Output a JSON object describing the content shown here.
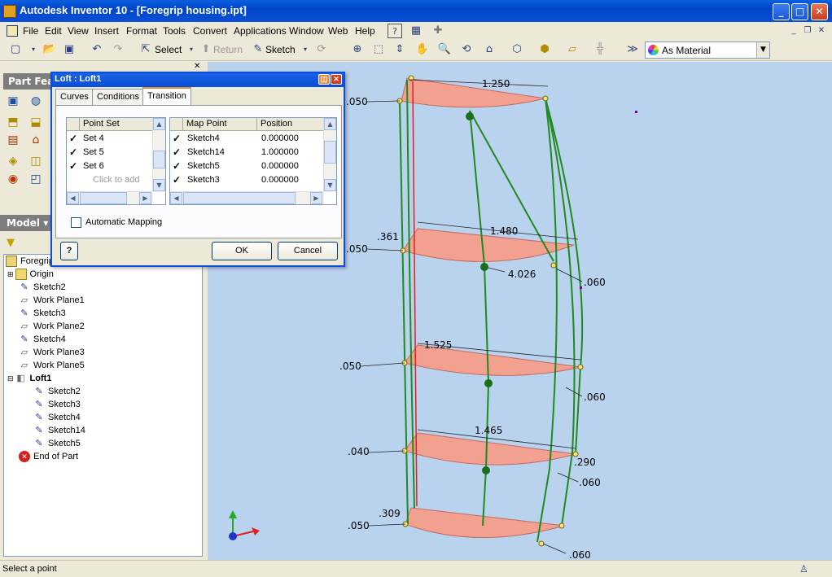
{
  "window": {
    "title": "Autodesk Inventor 10 - [Foregrip housing.ipt]"
  },
  "menu": [
    "File",
    "Edit",
    "View",
    "Insert",
    "Format",
    "Tools",
    "Convert",
    "Applications",
    "Window",
    "Web",
    "Help"
  ],
  "toolbar": {
    "select": "Select",
    "return": "Return",
    "sketch": "Sketch",
    "material": "As Material"
  },
  "panel": {
    "title": "Part Fea",
    "model": "Model"
  },
  "tree": [
    {
      "label": "Foregrip",
      "icon": "part-icon"
    },
    {
      "label": "Origin",
      "icon": "folder-icon"
    },
    {
      "label": "Sketch2",
      "icon": "sketch-icon"
    },
    {
      "label": "Work Plane1",
      "icon": "plane-icon"
    },
    {
      "label": "Sketch3",
      "icon": "sketch-icon"
    },
    {
      "label": "Work Plane2",
      "icon": "plane-icon"
    },
    {
      "label": "Sketch4",
      "icon": "sketch-icon"
    },
    {
      "label": "Work Plane3",
      "icon": "plane-icon"
    },
    {
      "label": "Work Plane5",
      "icon": "plane-icon"
    },
    {
      "label": "Loft1",
      "icon": "loft-icon"
    },
    {
      "label": "Sketch2",
      "icon": "sketch-icon"
    },
    {
      "label": "Sketch3",
      "icon": "sketch-icon"
    },
    {
      "label": "Sketch4",
      "icon": "sketch-icon"
    },
    {
      "label": "Sketch14",
      "icon": "sketch-icon"
    },
    {
      "label": "Sketch5",
      "icon": "sketch-icon"
    },
    {
      "label": "End of Part",
      "icon": "end-of-part-icon"
    }
  ],
  "dialog": {
    "title": "Loft : Loft1",
    "tabs": [
      "Curves",
      "Conditions",
      "Transition"
    ],
    "active_tab": "Transition",
    "pointset_header": "Point Set",
    "pointsets": [
      "Set 4",
      "Set 5",
      "Set 6"
    ],
    "pointset_add": "Click to add",
    "map_headers": [
      "Map Point",
      "Position"
    ],
    "map_rows": [
      {
        "point": "Sketch4",
        "pos": "0.000000"
      },
      {
        "point": "Sketch14",
        "pos": "1.000000"
      },
      {
        "point": "Sketch5",
        "pos": "0.000000"
      },
      {
        "point": "Sketch3",
        "pos": "0.000000"
      }
    ],
    "auto_mapping": "Automatic Mapping",
    "ok": "OK",
    "cancel": "Cancel"
  },
  "dims": {
    "d1250": "1.250",
    "d1480": "1.480",
    "d1525": "1.525",
    "d1465": "1.465",
    "d050a": ".050",
    "d050b": ".050",
    "d050c": ".050",
    "d050d": ".050",
    "d040": ".040",
    "d361": ".361",
    "d4026": "4.026",
    "d060a": ".060",
    "d060b": ".060",
    "d060c": ".060",
    "d060d": ".060",
    "d290": ".290",
    "d309": ".309"
  },
  "status": "Select a point"
}
